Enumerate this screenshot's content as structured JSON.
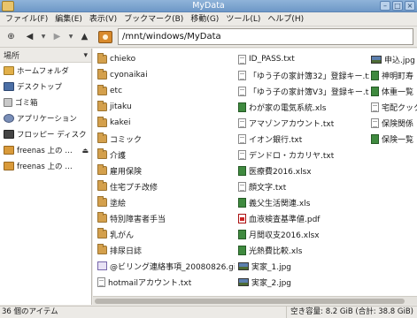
{
  "window": {
    "title": "MyData"
  },
  "menubar": {
    "items": [
      "ファイル(F)",
      "編集(E)",
      "表示(V)",
      "ブックマーク(B)",
      "移動(G)",
      "ツール(L)",
      "ヘルプ(H)"
    ]
  },
  "toolbar": {
    "path": "/mnt/windows/MyData",
    "icons": [
      "new-tab-icon",
      "back-icon",
      "back-history-icon",
      "forward-icon",
      "forward-history-icon",
      "up-icon",
      "home-icon"
    ]
  },
  "sidebar": {
    "header": "場所",
    "items": [
      {
        "label": "ホームフォルダ",
        "icon": "home-folder-icon"
      },
      {
        "label": "デスクトップ",
        "icon": "desktop-icon"
      },
      {
        "label": "ゴミ箱",
        "icon": "trash-icon"
      },
      {
        "label": "アプリケーション",
        "icon": "applications-icon"
      },
      {
        "label": "フロッピー ディスク",
        "icon": "floppy-icon"
      },
      {
        "label": "freenas 上の …",
        "icon": "network-folder-icon",
        "eject": true
      },
      {
        "label": "freenas 上の …",
        "icon": "network-folder-icon",
        "eject": false
      }
    ]
  },
  "files": {
    "col1": [
      {
        "name": "chieko",
        "type": "folder"
      },
      {
        "name": "cyonaikai",
        "type": "folder"
      },
      {
        "name": "etc",
        "type": "folder"
      },
      {
        "name": "jitaku",
        "type": "folder"
      },
      {
        "name": "kakei",
        "type": "folder"
      },
      {
        "name": "コミック",
        "type": "folder"
      },
      {
        "name": "介護",
        "type": "folder"
      },
      {
        "name": "雇用保険",
        "type": "folder"
      },
      {
        "name": "住宅プチ改修",
        "type": "folder"
      },
      {
        "name": "塗絵",
        "type": "folder"
      },
      {
        "name": "特別障害者手当",
        "type": "folder"
      },
      {
        "name": "乳がん",
        "type": "folder"
      },
      {
        "name": "排尿日誌",
        "type": "folder"
      },
      {
        "name": "@ビリング連絡事項_20080826.gif",
        "type": "gif"
      },
      {
        "name": "hotmailアカウント.txt",
        "type": "text"
      }
    ],
    "col2": [
      {
        "name": "ID_PASS.txt",
        "type": "text"
      },
      {
        "name": "「ゆう子の家計簿32」登録キー.txt",
        "type": "text"
      },
      {
        "name": "「ゆう子の家計簿V3」登録キー.txt",
        "type": "text"
      },
      {
        "name": "わが家の電気系統.xls",
        "type": "xls"
      },
      {
        "name": "アマゾンアカウント.txt",
        "type": "text"
      },
      {
        "name": "イオン銀行.txt",
        "type": "text"
      },
      {
        "name": "デンドロ・カカリヤ.txt",
        "type": "text"
      },
      {
        "name": "医療費2016.xlsx",
        "type": "xls"
      },
      {
        "name": "顔文字.txt",
        "type": "text"
      },
      {
        "name": "義父生活関連.xls",
        "type": "xls"
      },
      {
        "name": "血液検査基準値.pdf",
        "type": "pdf"
      },
      {
        "name": "月間収支2016.xlsx",
        "type": "xls"
      },
      {
        "name": "光熱費比較.xls",
        "type": "xls"
      },
      {
        "name": "実家_1.jpg",
        "type": "img"
      },
      {
        "name": "実家_2.jpg",
        "type": "img"
      }
    ],
    "col3": [
      {
        "name": "申込.jpg",
        "type": "img"
      },
      {
        "name": "神明町寿",
        "type": "xls"
      },
      {
        "name": "体重一覧",
        "type": "xls"
      },
      {
        "name": "宅配クック",
        "type": "text"
      },
      {
        "name": "保険関係",
        "type": "text"
      },
      {
        "name": "保険一覧",
        "type": "xls"
      }
    ]
  },
  "statusbar": {
    "items_count": "36 個のアイテム",
    "free_space": "空き容量: 8.2 GiB (合計: 38.8 GiB)"
  }
}
